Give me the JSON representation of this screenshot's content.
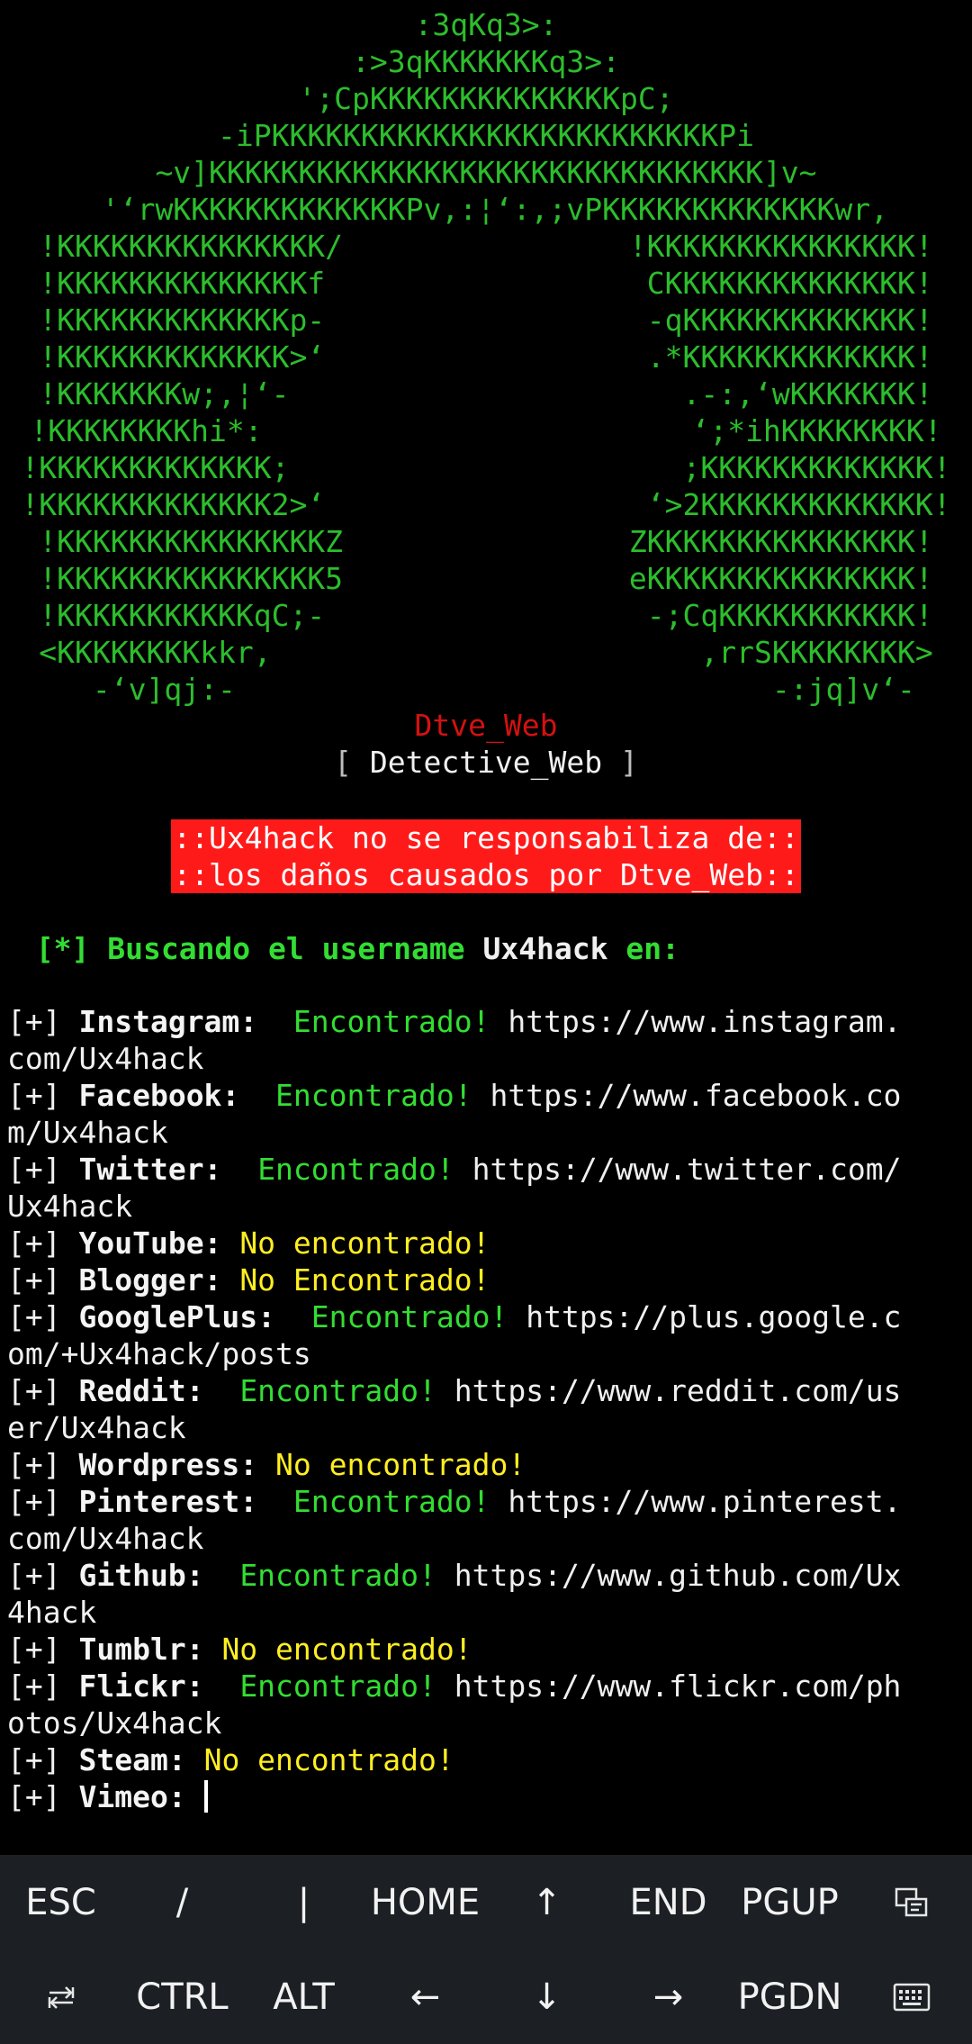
{
  "ascii_art": [
    ":3qKq3>:",
    ":>3qKKKKKKKq3>:",
    "';CpKKKKKKKKKKKKKKpC;",
    "-iPKKKKKKKKKKKKKKKKKKKKKKKKKPi",
    "~v]KKKKKKKKKKKKKKKKKKKKKKKKKKKKKKK]v~",
    " '‘rwKKKKKKKKKKKKKPv,:¦‘:,;vPKKKKKKKKKKKKKwr,",
    "!KKKKKKKKKKKKKKK/                !KKKKKKKKKKKKKKK!",
    "!KKKKKKKKKKKKKKf                  CKKKKKKKKKKKKKK!",
    "!KKKKKKKKKKKKKp-                  -qKKKKKKKKKKKKK!",
    "!KKKKKKKKKKKKK>‘                  .*KKKKKKKKKKKKK!",
    "!KKKKKKKw;,¦‘-                      .-:,‘wKKKKKKK!",
    "!KKKKKKKKhi*:                        ‘;*ihKKKKKKKK!",
    "!KKKKKKKKKKKKK;                      ;KKKKKKKKKKKKK!",
    "!KKKKKKKKKKKKK2>‘                  ‘>2KKKKKKKKKKKKK!",
    "!KKKKKKKKKKKKKKKZ                ZKKKKKKKKKKKKKKK!",
    "!KKKKKKKKKKKKKKK5                eKKKKKKKKKKKKKKK!",
    "!KKKKKKKKKKKqC;-                  -;CqKKKKKKKKKKK!",
    "<KKKKKKKKkkr,                        ,rrSKKKKKKKK>",
    "  -‘v]qj:-                              -:jq]v‘-"
  ],
  "tool": {
    "name": "Dtve_Web",
    "full_name": "Detective_Web",
    "bracket_open": "[",
    "bracket_close": "]"
  },
  "warning": {
    "line1": "::Ux4hack no se responsabiliza de::",
    "line2": "::los daños causados por Dtve_Web::"
  },
  "search": {
    "prefix": "[*]",
    "text": " Buscando el username ",
    "username": "Ux4hack",
    "suffix": " en:"
  },
  "results": [
    {
      "marker": "[+]",
      "site": "Instagram:",
      "status": "found",
      "status_text": "Encontrado!",
      "url_part1": "https://www.instagram.",
      "url_part2": "com/Ux4hack"
    },
    {
      "marker": "[+]",
      "site": "Facebook:",
      "status": "found",
      "status_text": "Encontrado!",
      "url_part1": "https://www.facebook.co",
      "url_part2": "m/Ux4hack"
    },
    {
      "marker": "[+]",
      "site": "Twitter:",
      "status": "found",
      "status_text": "Encontrado!",
      "url_part1": "https://www.twitter.com/",
      "url_part2": "Ux4hack"
    },
    {
      "marker": "[+]",
      "site": "YouTube:",
      "status": "not_found",
      "status_text": "No encontrado!"
    },
    {
      "marker": "[+]",
      "site": "Blogger:",
      "status": "not_found",
      "status_text": "No Encontrado!"
    },
    {
      "marker": "[+]",
      "site": "GooglePlus:",
      "status": "found",
      "status_text": "Encontrado!",
      "url_part1": "https://plus.google.c",
      "url_part2": "om/+Ux4hack/posts"
    },
    {
      "marker": "[+]",
      "site": "Reddit:",
      "status": "found",
      "status_text": "Encontrado!",
      "url_part1": "https://www.reddit.com/us",
      "url_part2": "er/Ux4hack"
    },
    {
      "marker": "[+]",
      "site": "Wordpress:",
      "status": "not_found",
      "status_text": "No encontrado!"
    },
    {
      "marker": "[+]",
      "site": "Pinterest:",
      "status": "found",
      "status_text": "Encontrado!",
      "url_part1": "https://www.pinterest.",
      "url_part2": "com/Ux4hack"
    },
    {
      "marker": "[+]",
      "site": "Github:",
      "status": "found",
      "status_text": "Encontrado!",
      "url_part1": "https://www.github.com/Ux",
      "url_part2": "4hack"
    },
    {
      "marker": "[+]",
      "site": "Tumblr:",
      "status": "not_found",
      "status_text": "No encontrado!"
    },
    {
      "marker": "[+]",
      "site": "Flickr:",
      "status": "found",
      "status_text": "Encontrado!",
      "url_part1": "https://www.flickr.com/ph",
      "url_part2": "otos/Ux4hack"
    },
    {
      "marker": "[+]",
      "site": "Steam:",
      "status": "not_found",
      "status_text": "No encontrado!"
    },
    {
      "marker": "[+]",
      "site": "Vimeo:",
      "status": "pending",
      "status_text": ""
    }
  ],
  "extra_keys": {
    "row1": [
      {
        "label": "ESC",
        "name": "key-esc"
      },
      {
        "label": "/",
        "name": "key-slash"
      },
      {
        "label": "|",
        "name": "key-pipe"
      },
      {
        "label": "HOME",
        "name": "key-home"
      },
      {
        "label": "↑",
        "name": "key-up"
      },
      {
        "label": "END",
        "name": "key-end"
      },
      {
        "label": "PGUP",
        "name": "key-pgup"
      },
      {
        "label": "",
        "name": "key-toggle-text-input",
        "icon": "text-input-icon"
      }
    ],
    "row2": [
      {
        "label": "",
        "name": "key-tab",
        "icon": "tab-icon"
      },
      {
        "label": "CTRL",
        "name": "key-ctrl"
      },
      {
        "label": "ALT",
        "name": "key-alt"
      },
      {
        "label": "←",
        "name": "key-left"
      },
      {
        "label": "↓",
        "name": "key-down"
      },
      {
        "label": "→",
        "name": "key-right"
      },
      {
        "label": "PGDN",
        "name": "key-pgdn"
      },
      {
        "label": "",
        "name": "key-keyboard",
        "icon": "keyboard-icon"
      }
    ]
  },
  "colors": {
    "background": "#000000",
    "art_green": "#2cbd2c",
    "found_green": "#33dd33",
    "not_found_yellow": "#ffee22",
    "tool_name_red": "#d41111",
    "warning_bg": "#ff1a1a",
    "keybar_bg": "#1c2024"
  }
}
